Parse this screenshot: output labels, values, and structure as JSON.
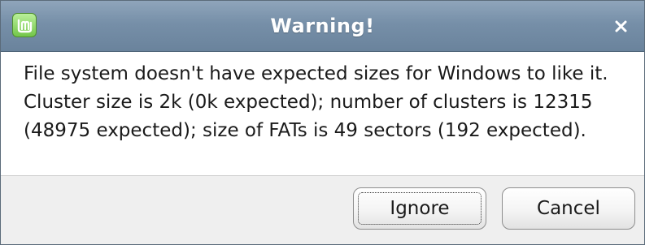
{
  "window": {
    "title": "Warning!",
    "app_icon": "linux-mint-logo-icon",
    "close_icon": "close-icon"
  },
  "message": {
    "text": "File system doesn't have expected sizes for Windows to like it. Cluster size is 2k (0k expected); number of clusters is 12315 (48975 expected); size of FATs is 49 sectors (192 expected)."
  },
  "buttons": {
    "ignore_label": "Ignore",
    "cancel_label": "Cancel"
  },
  "colors": {
    "titlebar": "#768fa8",
    "title_text": "#ffffff",
    "logo_green": "#73c64a",
    "content_bg": "#ffffff",
    "button_area_bg": "#efefef"
  }
}
